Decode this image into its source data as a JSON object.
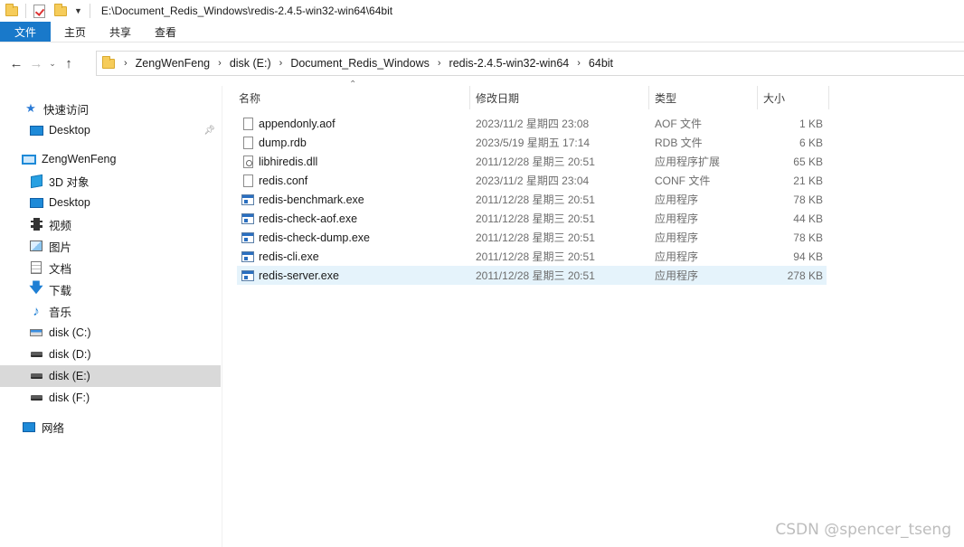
{
  "window": {
    "title_path": "E:\\Document_Redis_Windows\\redis-2.4.5-win32-win64\\64bit",
    "qa_icons": [
      "folder-icon",
      "properties-icon",
      "new-folder-icon",
      "customize-arrow-icon"
    ]
  },
  "ribbon": {
    "file": "文件",
    "tabs": [
      "主页",
      "共享",
      "查看"
    ]
  },
  "address": {
    "breadcrumbs": [
      "ZengWenFeng",
      "disk (E:)",
      "Document_Redis_Windows",
      "redis-2.4.5-win32-win64",
      "64bit"
    ]
  },
  "sidebar": {
    "items": [
      {
        "label": "快速访问",
        "icon": "star-icon"
      },
      {
        "label": "Desktop",
        "icon": "desktop-icon",
        "pinned": true
      },
      {
        "label": "ZengWenFeng",
        "icon": "computer-icon"
      },
      {
        "label": "3D 对象",
        "icon": "3d-objects-icon"
      },
      {
        "label": "Desktop",
        "icon": "desktop-icon"
      },
      {
        "label": "视频",
        "icon": "video-icon"
      },
      {
        "label": "图片",
        "icon": "pictures-icon"
      },
      {
        "label": "文档",
        "icon": "documents-icon"
      },
      {
        "label": "下载",
        "icon": "download-icon"
      },
      {
        "label": "音乐",
        "icon": "music-icon"
      },
      {
        "label": "disk (C:)",
        "icon": "system-drive-icon"
      },
      {
        "label": "disk (D:)",
        "icon": "drive-icon"
      },
      {
        "label": "disk (E:)",
        "icon": "drive-icon",
        "selected": true
      },
      {
        "label": "disk (F:)",
        "icon": "drive-icon"
      },
      {
        "label": "网络",
        "icon": "network-icon"
      }
    ]
  },
  "columns": {
    "name": "名称",
    "date": "修改日期",
    "type": "类型",
    "size": "大小"
  },
  "files": [
    {
      "name": "appendonly.aof",
      "date": "2023/11/2 星期四 23:08",
      "type": "AOF 文件",
      "size": "1 KB",
      "icon": "file-icon"
    },
    {
      "name": "dump.rdb",
      "date": "2023/5/19 星期五 17:14",
      "type": "RDB 文件",
      "size": "6 KB",
      "icon": "file-icon"
    },
    {
      "name": "libhiredis.dll",
      "date": "2011/12/28 星期三 20:51",
      "type": "应用程序扩展",
      "size": "65 KB",
      "icon": "dll-icon"
    },
    {
      "name": "redis.conf",
      "date": "2023/11/2 星期四 23:04",
      "type": "CONF 文件",
      "size": "21 KB",
      "icon": "file-icon"
    },
    {
      "name": "redis-benchmark.exe",
      "date": "2011/12/28 星期三 20:51",
      "type": "应用程序",
      "size": "78 KB",
      "icon": "exe-icon"
    },
    {
      "name": "redis-check-aof.exe",
      "date": "2011/12/28 星期三 20:51",
      "type": "应用程序",
      "size": "44 KB",
      "icon": "exe-icon"
    },
    {
      "name": "redis-check-dump.exe",
      "date": "2011/12/28 星期三 20:51",
      "type": "应用程序",
      "size": "78 KB",
      "icon": "exe-icon"
    },
    {
      "name": "redis-cli.exe",
      "date": "2011/12/28 星期三 20:51",
      "type": "应用程序",
      "size": "94 KB",
      "icon": "exe-icon"
    },
    {
      "name": "redis-server.exe",
      "date": "2011/12/28 星期三 20:51",
      "type": "应用程序",
      "size": "278 KB",
      "icon": "exe-icon",
      "selected": true
    }
  ],
  "watermark": "CSDN @spencer_tseng",
  "colors": {
    "file_tab": "#1979ca",
    "selected_row": "#e5f3fb",
    "selected_sidebar": "#d9d9d9"
  }
}
